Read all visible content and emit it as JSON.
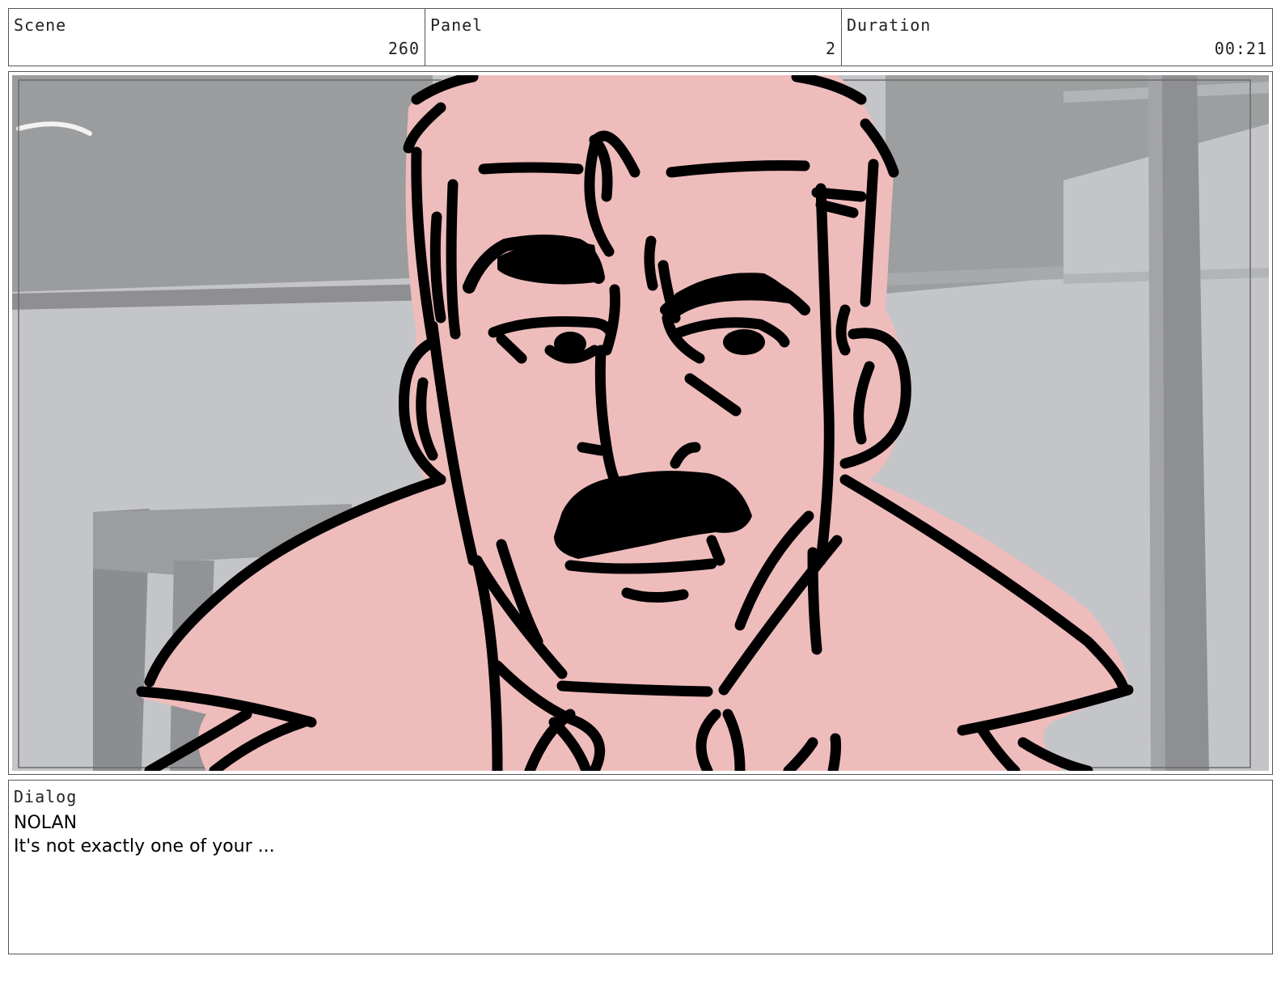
{
  "header": {
    "scene": {
      "label": "Scene",
      "value": "260"
    },
    "panel": {
      "label": "Panel",
      "value": "2"
    },
    "duration": {
      "label": "Duration",
      "value": "00:21"
    }
  },
  "panel_image": {
    "subject": "sketch-of-mustached-man-in-coat",
    "colors": {
      "skin": "#efbcbc",
      "ink": "#000000",
      "ceiling": "#9a9b9d",
      "wall": "#c4c5c9",
      "pillar": "#8f9093"
    }
  },
  "dialog": {
    "label": "Dialog",
    "speaker": "NOLAN",
    "line": "It's not exactly one of your ..."
  }
}
